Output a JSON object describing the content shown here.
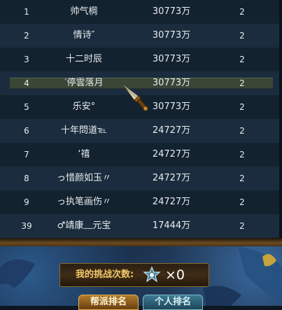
{
  "ranking": {
    "rows": [
      {
        "rank": "1",
        "name": "帅气棡",
        "power": "30773万",
        "level": "2"
      },
      {
        "rank": "2",
        "name": "情诗″",
        "power": "30773万",
        "level": "2"
      },
      {
        "rank": "3",
        "name": "十二时辰",
        "power": "30773万",
        "level": "2"
      },
      {
        "rank": "4",
        "name": "′停雲落月",
        "power": "30773万",
        "level": "2"
      },
      {
        "rank": "5",
        "name": "乐安°",
        "power": "30773万",
        "level": "2"
      },
      {
        "rank": "6",
        "name": "十年問道℡",
        "power": "24727万",
        "level": "2"
      },
      {
        "rank": "7",
        "name": "‘禧",
        "power": "24727万",
        "level": "2"
      },
      {
        "rank": "8",
        "name": "っ惜颜如玉〃",
        "power": "24727万",
        "level": "2"
      },
      {
        "rank": "9",
        "name": "っ执笔画伤〃",
        "power": "24727万",
        "level": "2"
      },
      {
        "rank": "39",
        "name": "♂靖康﹏元宝",
        "power": "17444万",
        "level": "2"
      }
    ],
    "selected_index": 3
  },
  "challenge": {
    "label": "我的挑战次数:",
    "count": "×0",
    "icon": "crown-emblem-icon"
  },
  "tabs": {
    "guild": "帮派排名",
    "personal": "个人排名"
  },
  "cursor_icon": "dagger-cursor-icon",
  "colors": {
    "gold_text": "#f2c86a",
    "row_alt": "#1a2c3d",
    "row_base": "#12222f",
    "selected": "#3a4636"
  }
}
